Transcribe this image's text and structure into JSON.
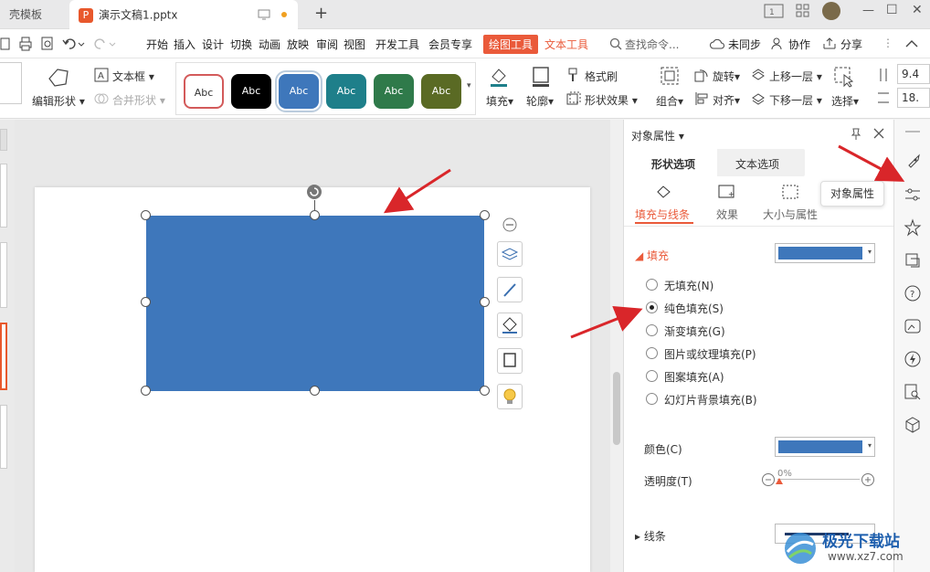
{
  "tabs": {
    "template": "壳模板",
    "doc": "演示文稿1.pptx",
    "new_tab": "+"
  },
  "window": {
    "min": "—",
    "max": "☐",
    "close": "✕"
  },
  "menu": {
    "items": [
      "开始",
      "插入",
      "设计",
      "切换",
      "动画",
      "放映",
      "审阅",
      "视图",
      "开发工具",
      "会员专享"
    ],
    "draw_tool": "绘图工具",
    "text_tool": "文本工具",
    "search": "查找命令...",
    "unsync": "未同步",
    "collab": "协作",
    "share": "分享"
  },
  "ribbon": {
    "edit_shape": "编辑形状",
    "textbox": "文本框",
    "merge_shape": "合并形状",
    "styles": [
      "Abc",
      "Abc",
      "Abc",
      "Abc",
      "Abc",
      "Abc"
    ],
    "fill": "填充",
    "outline": "轮廓",
    "format_brush": "格式刷",
    "shape_effect": "形状效果",
    "group": "组合",
    "rotate": "旋转",
    "align": "对齐",
    "bring_forward": "上移一层",
    "send_backward": "下移一层",
    "select": "选择",
    "height": "9.4",
    "width": "18."
  },
  "panel": {
    "title": "对象属性",
    "tab_shape": "形状选项",
    "tab_text": "文本选项",
    "sub_fill_line": "填充与线条",
    "sub_effect": "效果",
    "sub_size": "大小与属性",
    "fill_section": "填充",
    "options": [
      "无填充(N)",
      "纯色填充(S)",
      "渐变填充(G)",
      "图片或纹理填充(P)",
      "图案填充(A)",
      "幻灯片背景填充(B)"
    ],
    "selected_index": 1,
    "color_label": "颜色(C)",
    "transparency_label": "透明度(T)",
    "transparency_value": "0%",
    "line_section": "线条"
  },
  "tooltip": "对象属性",
  "watermark": {
    "title": "极光下载站",
    "url": "www.xz7.com"
  },
  "colors": {
    "shape_fill": "#3e77bb",
    "accent": "#ea5a3a",
    "arrow": "#d9262a"
  }
}
